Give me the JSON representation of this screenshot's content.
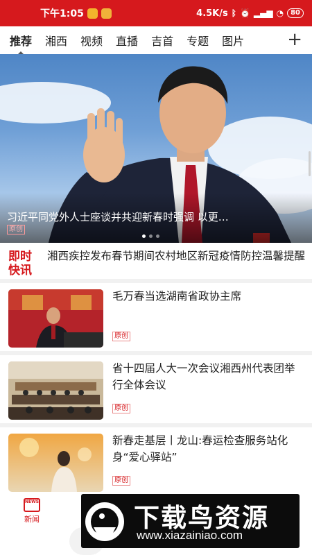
{
  "status_bar": {
    "time": "下午1:05",
    "network_speed": "4.5K/s",
    "battery": "80",
    "icons": [
      "bluetooth-icon",
      "alarm-icon",
      "hd-icon",
      "signal-icon",
      "wifi-icon",
      "battery-icon"
    ]
  },
  "tabs": [
    {
      "label": "推荐",
      "active": true
    },
    {
      "label": "湘西",
      "active": false
    },
    {
      "label": "视频",
      "active": false
    },
    {
      "label": "直播",
      "active": false
    },
    {
      "label": "吉首",
      "active": false
    },
    {
      "label": "专题",
      "active": false
    },
    {
      "label": "图片",
      "active": false
    }
  ],
  "tab_more_glyph": "+",
  "hero": {
    "title": "习近平同党外人士座谈并共迎新春时强调  以更…",
    "tag": "原创",
    "dot_count": 3,
    "active_dot": 0
  },
  "flash": {
    "badge_line1": "即时",
    "badge_line2": "快讯",
    "text": "湘西疾控发布春节期间农村地区新冠疫情防控温馨提醒"
  },
  "news": [
    {
      "title": "毛万春当选湖南省政协主席",
      "tag": "原创"
    },
    {
      "title": "省十四届人大一次会议湘西州代表团举行全体会议",
      "tag": "原创"
    },
    {
      "title": "新春走基层丨龙山:春运检查服务站化身“爱心驿站”",
      "tag": "原创"
    }
  ],
  "bottom_nav": {
    "news_label": "新闻",
    "news_icon_text": "NEWS"
  },
  "watermark": {
    "title": "下载鸟资源",
    "url": "www.xiazainiao.com"
  },
  "colors": {
    "brand_red": "#d6191d",
    "divider": "#f1f1f1"
  }
}
